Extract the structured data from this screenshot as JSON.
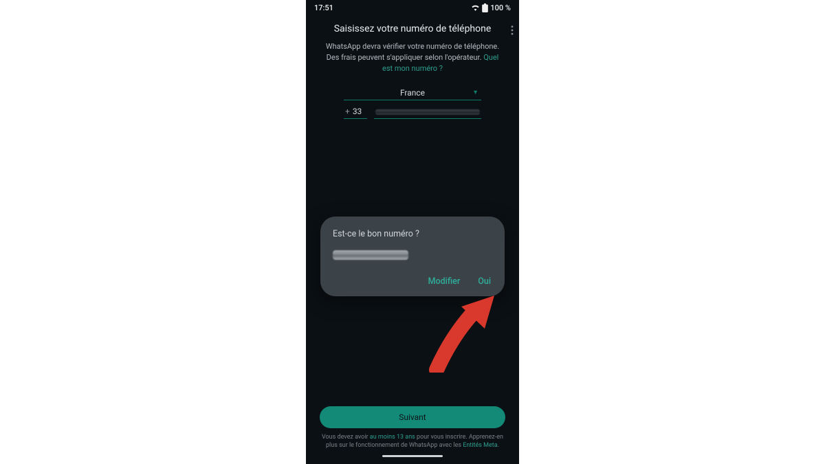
{
  "status": {
    "time": "17:51",
    "battery": "100 %"
  },
  "header": {
    "title": "Saisissez votre numéro de téléphone"
  },
  "instructions": {
    "text": "WhatsApp devra vérifier votre numéro de téléphone. Des frais peuvent s'appliquer selon l'opérateur. ",
    "link": "Quel est mon numéro ?"
  },
  "country": {
    "name": "France",
    "code": "33",
    "plus": "+"
  },
  "dialog": {
    "title": "Est-ce le bon numéro ?",
    "modify": "Modifier",
    "confirm": "Oui"
  },
  "footer": {
    "primary": "Suivant",
    "legal_pre": "Vous devez avoir ",
    "legal_age": "au moins 13 ans",
    "legal_mid": " pour vous inscrire. Apprenez-en plus sur le fonctionnement de WhatsApp avec les ",
    "legal_entities": "Entités Meta",
    "legal_end": "."
  }
}
